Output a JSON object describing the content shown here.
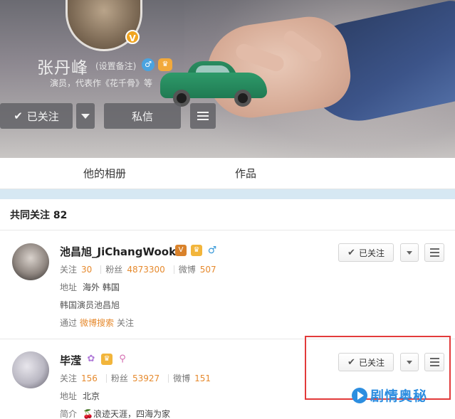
{
  "profile": {
    "name": "张丹峰",
    "remark": "(设置备注)",
    "description": "演员，代表作《花千骨》等",
    "follow_label": "已关注",
    "message_label": "私信",
    "verified_badge": "V"
  },
  "tabs": [
    {
      "label": "他的相册"
    },
    {
      "label": "作品"
    }
  ],
  "common_follow": {
    "title": "共同关注 82"
  },
  "users": [
    {
      "name": "池昌旭_JiChangWook",
      "follow_label": "关注",
      "follow_count": "30",
      "fans_label": "粉丝",
      "fans_count": "4873300",
      "weibo_label": "微博",
      "weibo_count": "507",
      "address_label": "地址",
      "address": "海外 韩国",
      "bio": "韩国演员池昌旭",
      "via_prefix": "通过",
      "via_link": "微博搜索",
      "via_suffix": "关注",
      "button_label": "已关注"
    },
    {
      "name": "毕滢",
      "follow_label": "关注",
      "follow_count": "156",
      "fans_label": "粉丝",
      "fans_count": "53927",
      "weibo_label": "微博",
      "weibo_count": "151",
      "address_label": "地址",
      "address": "北京",
      "intro_label": "简介",
      "intro": "🍒浪迹天涯，四海为家",
      "button_label": "已关注"
    }
  ],
  "watermark": {
    "text": "剧情奥秘"
  },
  "colors": {
    "accent_orange": "#e68a2e",
    "highlight_red": "#e23a3a",
    "stripe_blue": "#d6e8f3",
    "watermark_blue": "#2d8ee0"
  }
}
